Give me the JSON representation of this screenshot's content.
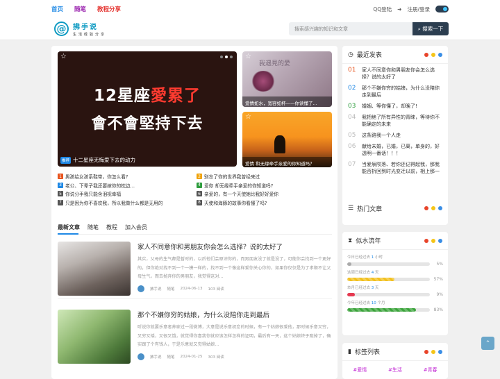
{
  "topbar": {
    "nav": [
      "首页",
      "随笔",
      "教程分享"
    ],
    "qq_login": "QQ登陆",
    "register_login": "注册/登录"
  },
  "header": {
    "logo_mark": "@",
    "site_name": "拂手说",
    "slogan": "生活经验分享",
    "search_placeholder": "搜索感兴趣的知识和文章",
    "search_button": "搜索一下"
  },
  "slider": {
    "line1_prefix": "12星座",
    "line1_highlight": "愛累了",
    "line2": "會不會堅持下去",
    "badge": "推荐",
    "caption": "十二星座无悔爱下去的动力"
  },
  "thumbs": [
    {
      "caption": "爱情如水，宽容如杯——你读懂了...",
      "overlay": "我遇見的愛"
    },
    {
      "caption": "爱情 和无缘牵手亲爱的你知道吗？"
    }
  ],
  "quick_links": [
    {
      "n": "1",
      "text": "男孩给女孩系鞋带，你怎么看?",
      "color": "#e8541e"
    },
    {
      "n": "2",
      "text": "别忘了你的世界我曾经来过",
      "color": "#f0a30a"
    },
    {
      "n": "3",
      "text": "老公、下辈子我还要嫁你的枕边...",
      "color": "#1e88e5"
    },
    {
      "n": "4",
      "text": "爱你 却无缘牵手亲爱的你知道吗?",
      "color": "#2e9d3e"
    },
    {
      "n": "5",
      "text": "你说分手我只能含泪祝幸福",
      "color": "#555555"
    },
    {
      "n": "6",
      "text": "亲爱的，有一个天使她比我好好爱你",
      "color": "#555555"
    },
    {
      "n": "7",
      "text": "只是因为你不喜欢我，所以我做什么都是无用的",
      "color": "#555555"
    },
    {
      "n": "8",
      "text": "天使和海豚的故事你看懂了吗?",
      "color": "#555555"
    }
  ],
  "tabs": [
    "最新文章",
    "随笔",
    "教程",
    "加入会员"
  ],
  "posts": [
    {
      "title": "家人不同意你和男朋友你会怎么选择？说的太好了",
      "excerpt": "其实，父母的生气都是暂时的，以后他们会原谅你的，而男朋友没了就是没了，可能你会找到一个更好的，但你绝对找不到一个一模一样的，找不到一个像这样爱你关心你的，如果你仅仅是为了孝顺不让父母生气，而去抛弃你的男朋友，我觉得这对...",
      "author": "拂手说",
      "cat": "随笔",
      "date": "2024-06-13",
      "views": "103 阅读"
    },
    {
      "title": "那个不嫌你穷的姑娘，为什么没陪你走到最后",
      "excerpt": "听说你就要乐意者养家过一段微博，大意是说乐意初恋的时候，有一个姑娘很爱他，那时候乐意又穷，又穷又矮，又很又饿，就觉得你喜我你就应该怎样怎样的证明，最后有一天，这个姑娘终于跑掉了，确实跟了个有钱人，于是乐意就又觉得姑娘...",
      "author": "拂手说",
      "cat": "随笔",
      "date": "2024-01-25",
      "views": "303 阅读"
    }
  ],
  "latest": {
    "title": "最近发表",
    "items": [
      {
        "n": "01",
        "text": "家人不同意你和男朋友你会怎么选择？说的太好了",
        "color": "#e8541e"
      },
      {
        "n": "02",
        "text": "那个不嫌你穷的姑娘，为什么没陪你走到最后",
        "color": "#1e88e5"
      },
      {
        "n": "03",
        "text": "婚姻、等你懂了，却晚了!",
        "color": "#2e9d3e"
      },
      {
        "n": "04",
        "text": "我把绝了所有异性的青睐，等待你不能确定的未来",
        "color": "#bbbbbb"
      },
      {
        "n": "05",
        "text": "这条路我一个人走",
        "color": "#bbbbbb"
      },
      {
        "n": "06",
        "text": "献给未婚，已婚，已离，单身的，好透明一番话！！！",
        "color": "#bbbbbb"
      },
      {
        "n": "07",
        "text": "当爱辰陨落、若你还记得起我，那我能否折回到时光变迁以前，相上那一",
        "color": "#bbbbbb"
      }
    ]
  },
  "hot": {
    "title": "热门文章"
  },
  "time": {
    "title": "似水流年",
    "rows": [
      {
        "label_pre": "今日已经过去",
        "value": "1",
        "unit": "小时",
        "pct": "5%",
        "fill": 0.05,
        "color": "#aaaaaa"
      },
      {
        "label_pre": "这周已经过去",
        "value": "4",
        "unit": "天",
        "pct": "57%",
        "fill": 0.57,
        "color": "#f2c01e"
      },
      {
        "label_pre": "本月已经过去",
        "value": "3",
        "unit": "天",
        "pct": "9%",
        "fill": 0.09,
        "color": "#e53950"
      },
      {
        "label_pre": "今年已经过去",
        "value": "10",
        "unit": "个月",
        "pct": "83%",
        "fill": 0.83,
        "color": "#3aa33a"
      }
    ]
  },
  "tags": {
    "title": "标签列表",
    "items": [
      "#爱情",
      "#生活",
      "#青春"
    ]
  },
  "colors": {
    "dot_red": "#e8442a",
    "dot_yellow": "#f5c518",
    "dot_blue": "#3a8ee6",
    "accent": "#1e88e5"
  }
}
